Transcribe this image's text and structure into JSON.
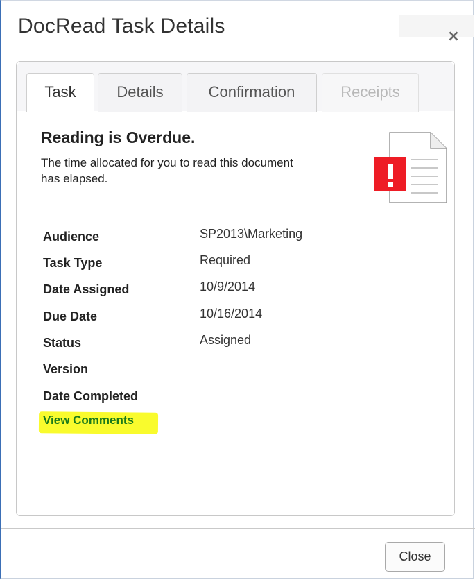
{
  "dialog": {
    "title": "DocRead Task Details",
    "close_glyph": "×"
  },
  "tabs": [
    {
      "label": "Task",
      "active": true
    },
    {
      "label": "Details"
    },
    {
      "label": "Confirmation"
    },
    {
      "label": "Receipts",
      "disabled": true
    }
  ],
  "message": {
    "heading": "Reading is Overdue.",
    "text": "The time allocated for you to read this document has elapsed.",
    "icon": "overdue-document-icon",
    "icon_color": "#ee1c25"
  },
  "fields": [
    {
      "label": "Audience",
      "value": "SP2013\\Marketing"
    },
    {
      "label": "Task Type",
      "value": "Required"
    },
    {
      "label": "Date Assigned",
      "value": "10/9/2014"
    },
    {
      "label": "Due Date",
      "value": "10/16/2014"
    },
    {
      "label": "Status",
      "value": "Assigned"
    },
    {
      "label": "Version",
      "value": ""
    },
    {
      "label": "Date Completed",
      "value": ""
    }
  ],
  "view_comments_link": "View Comments",
  "footer": {
    "close_label": "Close"
  },
  "colors": {
    "link": "#1a7a1a",
    "highlight": "#f9fb2d",
    "dialog_border": "#3b6fb6"
  }
}
